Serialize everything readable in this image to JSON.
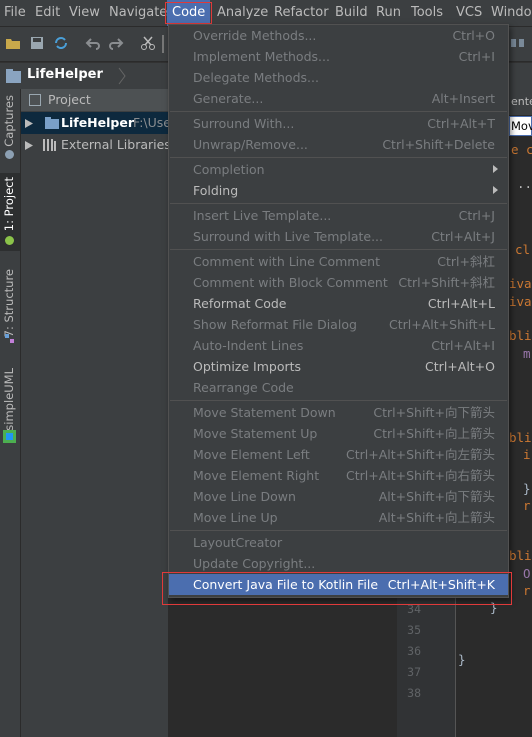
{
  "menubar": {
    "items": [
      "File",
      "Edit",
      "View",
      "Navigate",
      "Code",
      "Analyze",
      "Refactor",
      "Build",
      "Run",
      "Tools",
      "VCS",
      "Window"
    ]
  },
  "navbar": {
    "project": "LifeHelper"
  },
  "left_tabs": [
    "Captures",
    "1: Project",
    "7: Structure",
    "simpleUML"
  ],
  "project_panel": {
    "header": "Project",
    "tree": [
      {
        "label": "LifeHelper",
        "path": "F:\\Use"
      },
      {
        "label": "External Libraries"
      }
    ]
  },
  "editor": {
    "tab_partial": "enter",
    "field_partial": "Mov",
    "line_numbers": [
      "34",
      "35",
      "36",
      "37",
      "38"
    ],
    "fragments": [
      "e c",
      "...",
      "cl",
      "iva",
      "iva",
      "bli",
      "m",
      "bli",
      "i",
      "}",
      "r",
      "bli",
      "O",
      "r",
      "}",
      "}"
    ]
  },
  "code_menu": {
    "items": [
      {
        "label": "Override Methods...",
        "shortcut": "Ctrl+O",
        "enabled": false
      },
      {
        "label": "Implement Methods...",
        "shortcut": "Ctrl+I",
        "enabled": false
      },
      {
        "label": "Delegate Methods...",
        "shortcut": "",
        "enabled": false
      },
      {
        "label": "Generate...",
        "shortcut": "Alt+Insert",
        "enabled": false
      },
      {
        "label": "Surround With...",
        "shortcut": "Ctrl+Alt+T",
        "enabled": false
      },
      {
        "label": "Unwrap/Remove...",
        "shortcut": "Ctrl+Shift+Delete",
        "enabled": false
      },
      {
        "label": "Completion",
        "shortcut": "",
        "enabled": false,
        "submenu": true
      },
      {
        "label": "Folding",
        "shortcut": "",
        "enabled": true,
        "submenu": true
      },
      {
        "label": "Insert Live Template...",
        "shortcut": "Ctrl+J",
        "enabled": false
      },
      {
        "label": "Surround with Live Template...",
        "shortcut": "Ctrl+Alt+J",
        "enabled": false
      },
      {
        "label": "Comment with Line Comment",
        "shortcut": "Ctrl+斜杠",
        "enabled": false
      },
      {
        "label": "Comment with Block Comment",
        "shortcut": "Ctrl+Shift+斜杠",
        "enabled": false
      },
      {
        "label": "Reformat Code",
        "shortcut": "Ctrl+Alt+L",
        "enabled": true
      },
      {
        "label": "Show Reformat File Dialog",
        "shortcut": "Ctrl+Alt+Shift+L",
        "enabled": false
      },
      {
        "label": "Auto-Indent Lines",
        "shortcut": "Ctrl+Alt+I",
        "enabled": false
      },
      {
        "label": "Optimize Imports",
        "shortcut": "Ctrl+Alt+O",
        "enabled": true
      },
      {
        "label": "Rearrange Code",
        "shortcut": "",
        "enabled": false
      },
      {
        "label": "Move Statement Down",
        "shortcut": "Ctrl+Shift+向下箭头",
        "enabled": false
      },
      {
        "label": "Move Statement Up",
        "shortcut": "Ctrl+Shift+向上箭头",
        "enabled": false
      },
      {
        "label": "Move Element Left",
        "shortcut": "Ctrl+Alt+Shift+向左箭头",
        "enabled": false
      },
      {
        "label": "Move Element Right",
        "shortcut": "Ctrl+Alt+Shift+向右箭头",
        "enabled": false
      },
      {
        "label": "Move Line Down",
        "shortcut": "Alt+Shift+向下箭头",
        "enabled": false
      },
      {
        "label": "Move Line Up",
        "shortcut": "Alt+Shift+向上箭头",
        "enabled": false
      },
      {
        "label": "LayoutCreator",
        "shortcut": "",
        "enabled": false
      },
      {
        "label": "Update Copyright...",
        "shortcut": "",
        "enabled": false
      },
      {
        "label": "Convert Java File to Kotlin File",
        "shortcut": "Ctrl+Alt+Shift+K",
        "enabled": true,
        "selected": true
      }
    ]
  },
  "colors": {
    "menu_bg": "#3c3f41",
    "selection": "#4b6eaf",
    "highlight_box": "#e03a3a",
    "disabled_text": "#7a7d80",
    "enabled_text": "#bbbbbb"
  }
}
